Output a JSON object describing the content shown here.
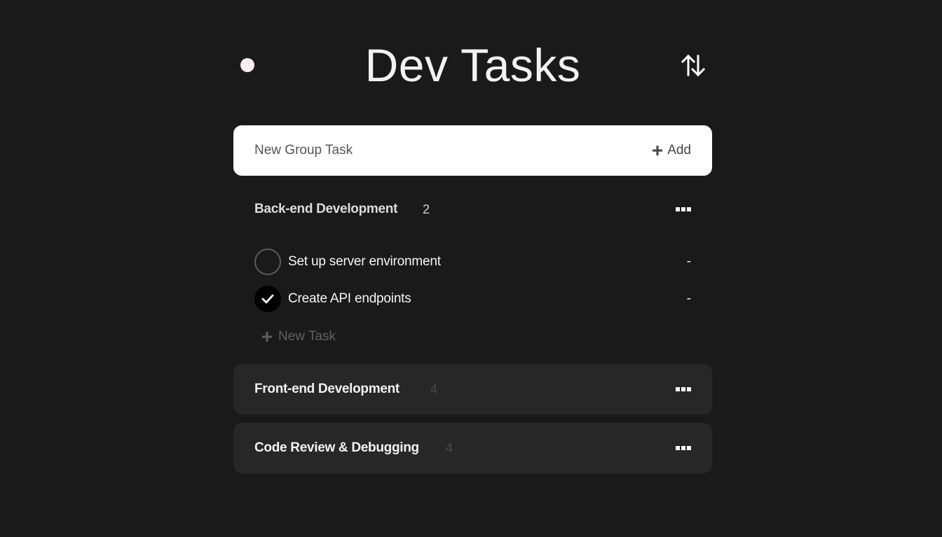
{
  "header": {
    "title": "Dev Tasks",
    "status_icon": "status-dot-icon",
    "sort_icon": "sort-arrows-icon"
  },
  "new_group": {
    "placeholder": "New Group Task",
    "add_label": "Add",
    "add_icon": "plus-icon"
  },
  "groups": [
    {
      "name": "Back-end Development",
      "count": "2",
      "expanded": true,
      "tasks": [
        {
          "label": "Set up server environment",
          "done": false,
          "action": "-"
        },
        {
          "label": "Create API endpoints",
          "done": true,
          "action": "-"
        }
      ],
      "new_task_label": "New Task"
    },
    {
      "name": "Front-end Development",
      "count": "4",
      "expanded": false
    },
    {
      "name": "Code Review & Debugging",
      "count": "4",
      "expanded": false
    }
  ],
  "colors": {
    "background": "#1a1a1a",
    "card": "#272727",
    "input_bg": "#ffffff",
    "accent_dot": "#f8eeee"
  }
}
